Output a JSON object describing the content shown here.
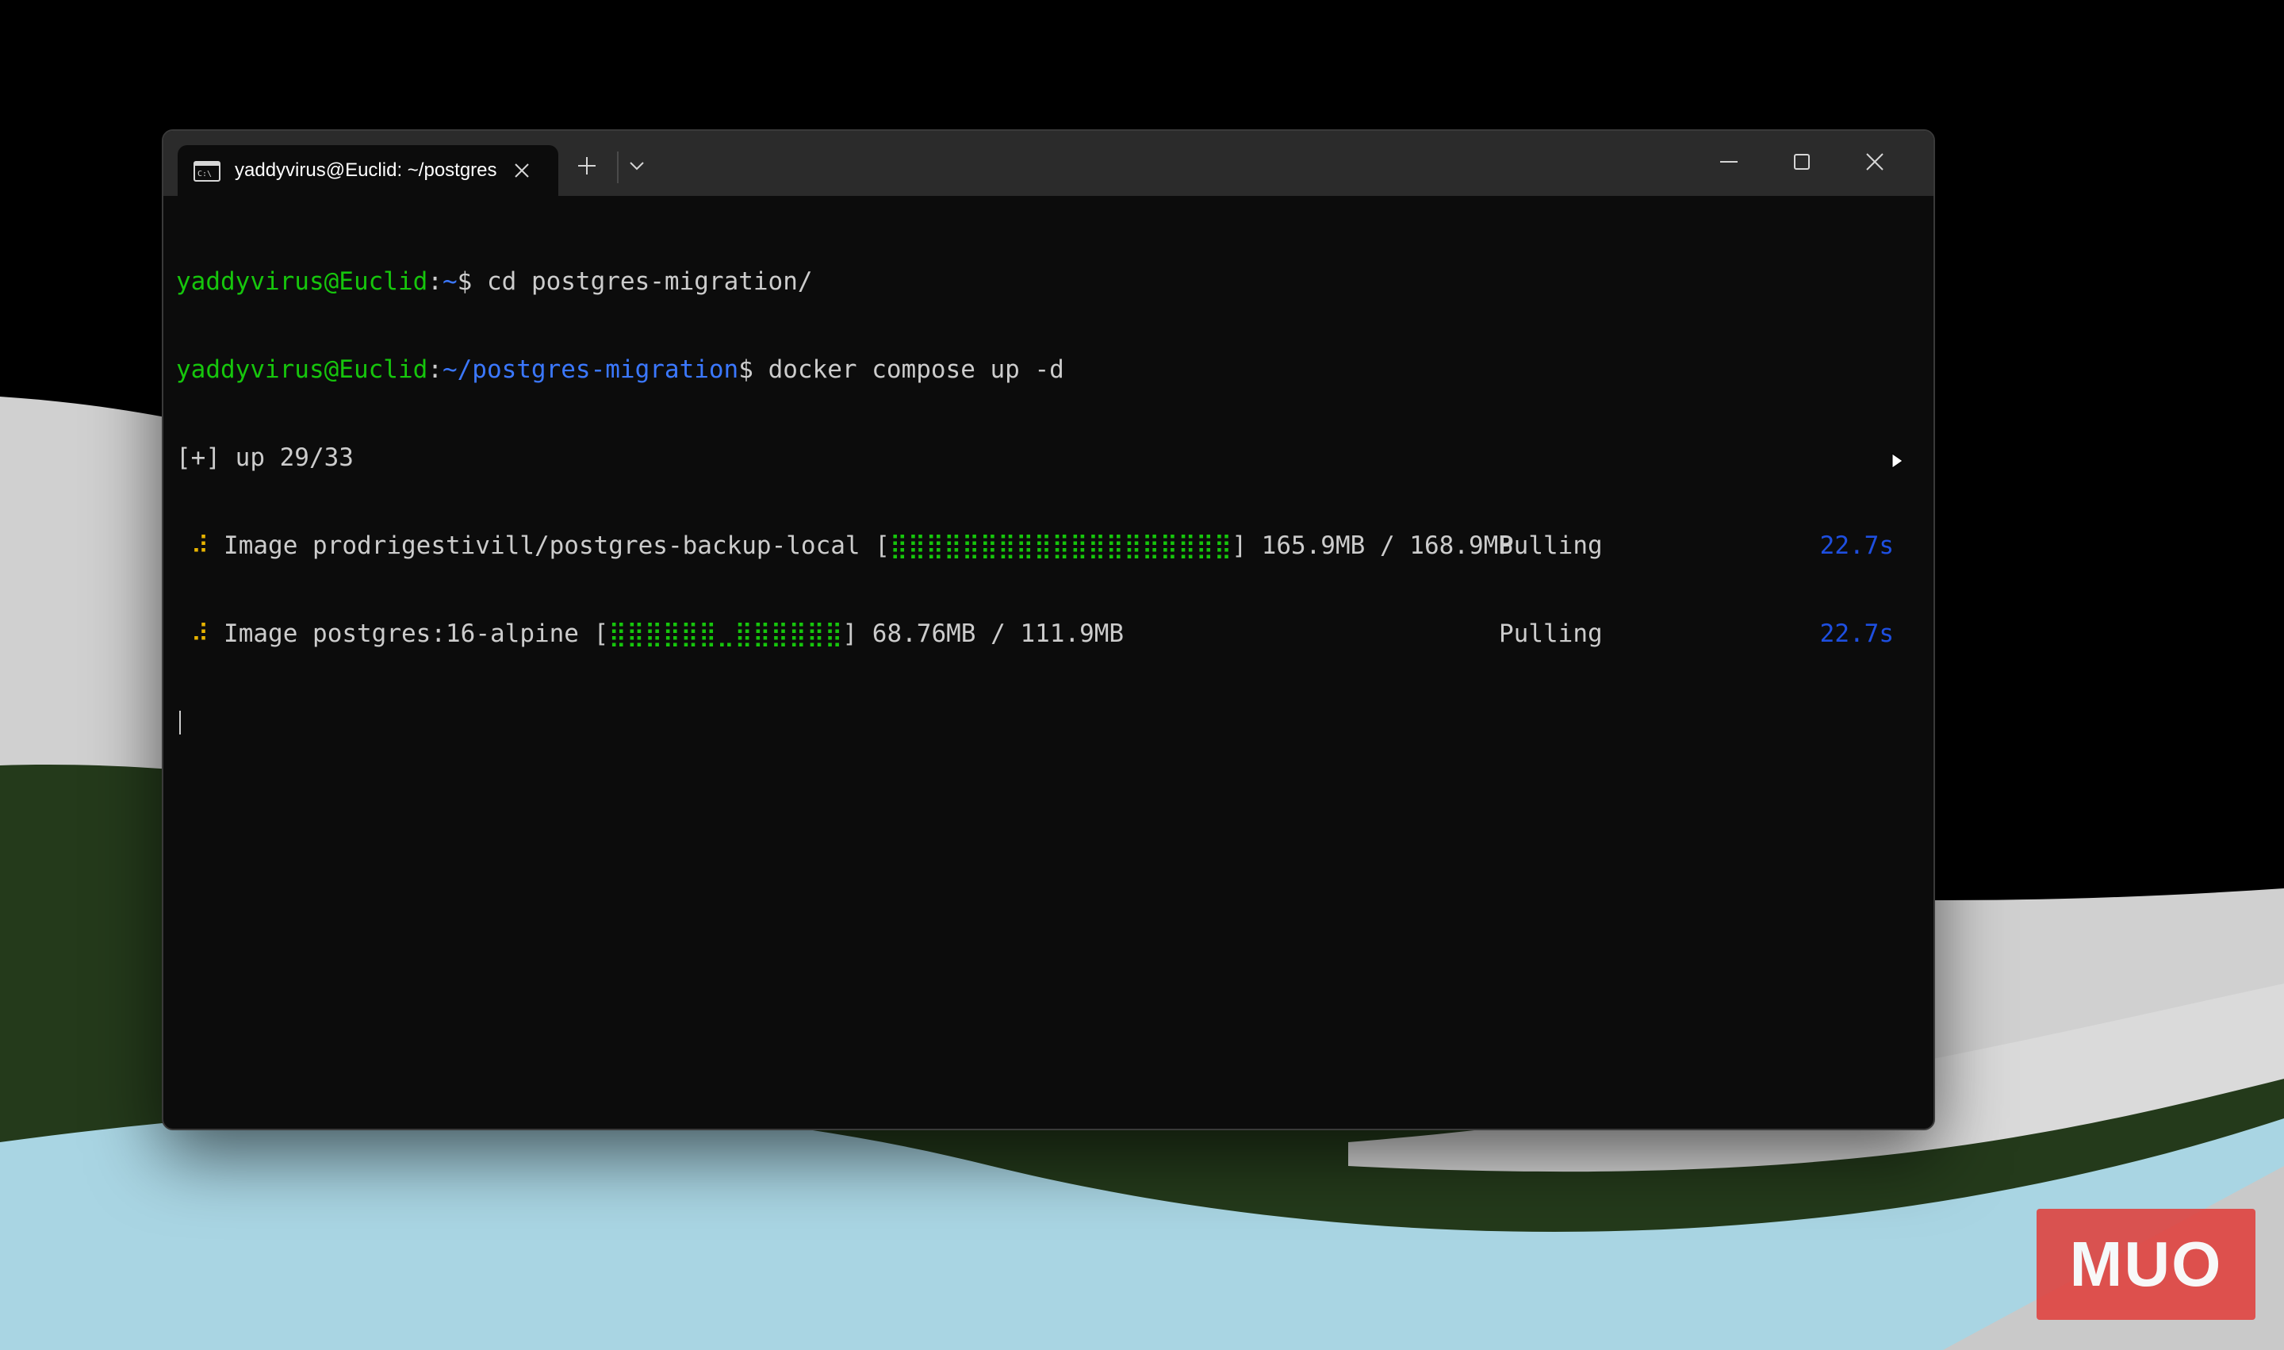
{
  "tab": {
    "title": "yaddyvirus@Euclid: ~/postgres-migration",
    "icon": "terminal-icon"
  },
  "toolbar": {
    "new_tab_icon": "plus-icon",
    "dropdown_icon": "chevron-down-icon"
  },
  "window_controls": {
    "minimize_icon": "minimize-icon",
    "maximize_icon": "maximize-icon",
    "close_icon": "close-icon"
  },
  "terminal": {
    "line1": {
      "user": "yaddyvirus@Euclid",
      "sep": ":",
      "path": "~",
      "prompt": "$ ",
      "command": "cd postgres-migration/"
    },
    "line2": {
      "user": "yaddyvirus@Euclid",
      "sep": ":",
      "path": "~/postgres-migration",
      "prompt": "$ ",
      "command": "docker compose up -d"
    },
    "line3": {
      "text": "[+] up 29/33"
    },
    "pull1": {
      "spinner": " ⠼ ",
      "label": "Image prodrigestivill/postgres-backup-local [",
      "bar": "⣿⣿⣿⣿⣿⣿⣿⣿⣿⣿⣿⣿⣿⣿⣿⣿⣿⣿⣿",
      "size": "] 165.9MB / 168.9MB",
      "status": "Pulling",
      "time": "22.7s"
    },
    "pull2": {
      "spinner": " ⠼ ",
      "label": "Image postgres:16-alpine [",
      "bar": "⣿⣿⣿⣿⣿⣿⣀⣿⣿⣿⣿⣿⣿",
      "size": "] 68.76MB / 111.9MB",
      "status": "Pulling",
      "time": "22.7s"
    }
  },
  "watermark": {
    "text": "MUO",
    "color": "#e0403c"
  }
}
